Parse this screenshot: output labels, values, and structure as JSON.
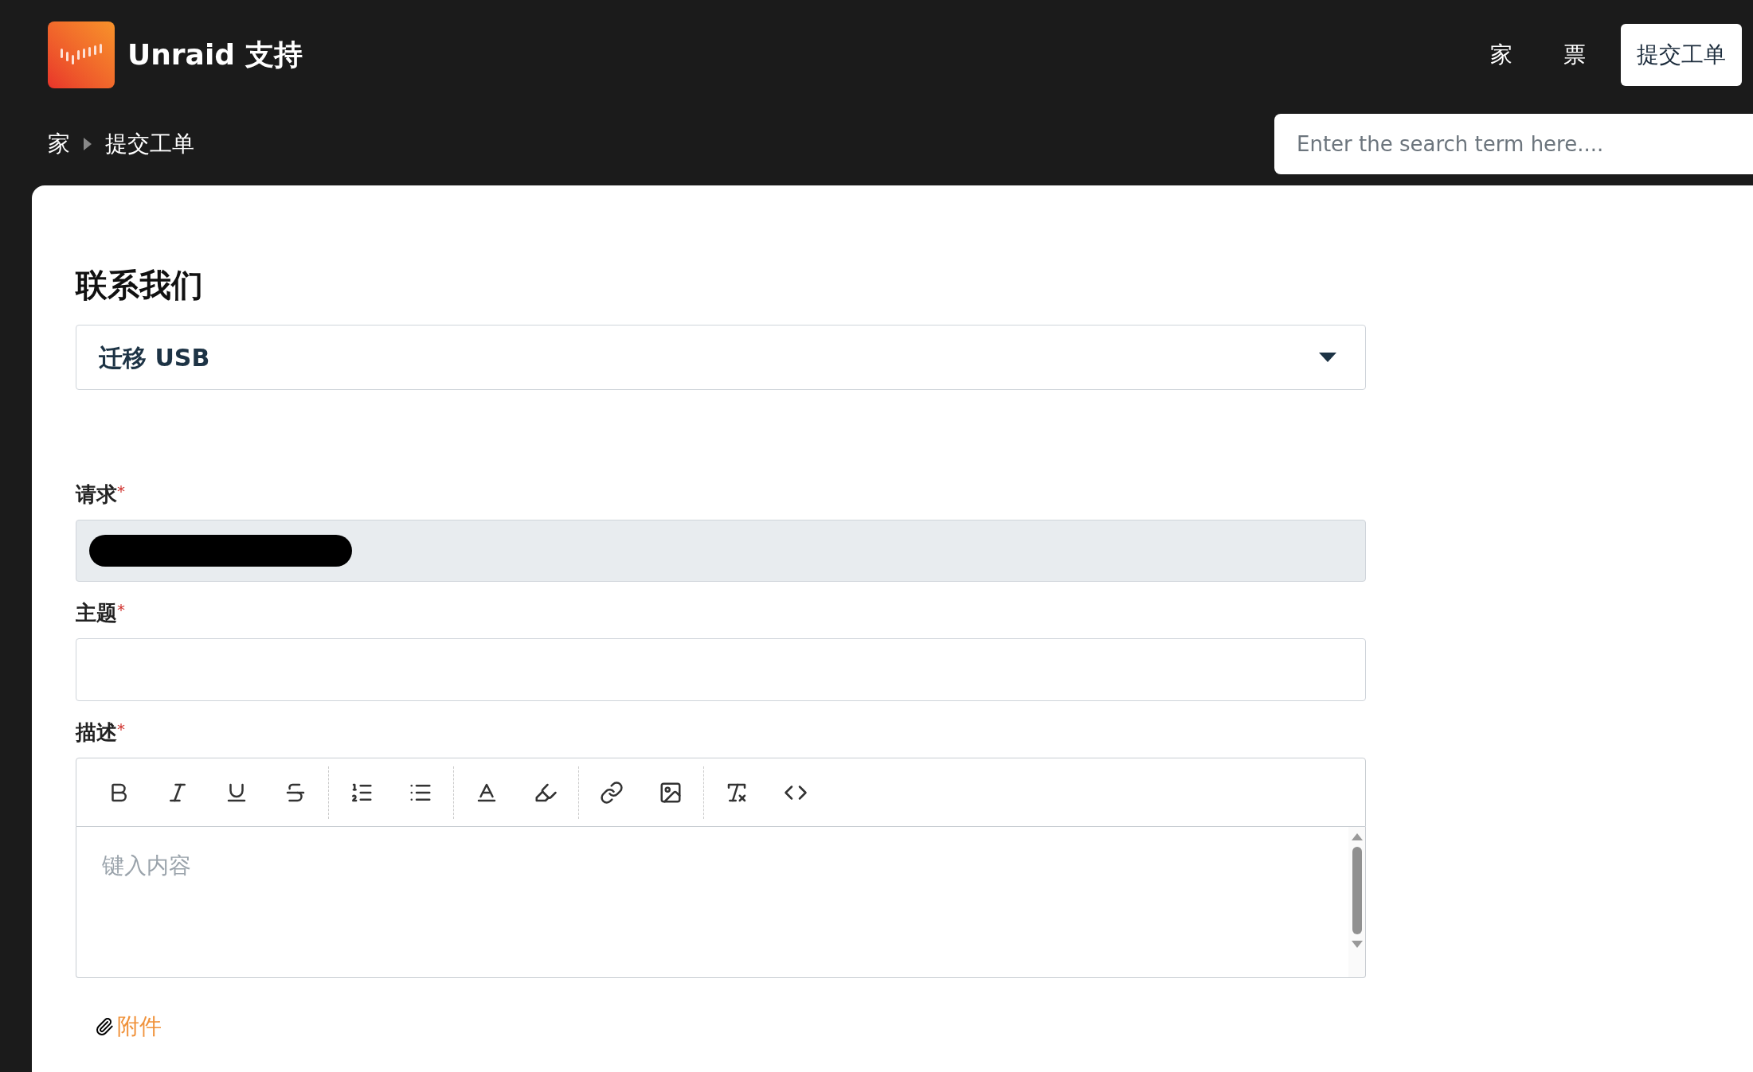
{
  "header": {
    "brand": "Unraid 支持",
    "nav": [
      {
        "label": "家",
        "selected": false
      },
      {
        "label": "票",
        "selected": false
      },
      {
        "label": "提交工单",
        "selected": true
      }
    ]
  },
  "breadcrumb": [
    "家",
    "提交工单"
  ],
  "search": {
    "placeholder": "Enter the search term here...."
  },
  "form": {
    "title": "联系我们",
    "topic": "迁移 USB",
    "fields": [
      {
        "label": "请求",
        "marker": "*",
        "kind": "redacted"
      },
      {
        "label": "主题",
        "marker": "*",
        "kind": "text"
      },
      {
        "label": "描述",
        "marker": "*",
        "kind": "editor",
        "placeholder": "键入内容"
      }
    ],
    "attachment": "附件"
  }
}
